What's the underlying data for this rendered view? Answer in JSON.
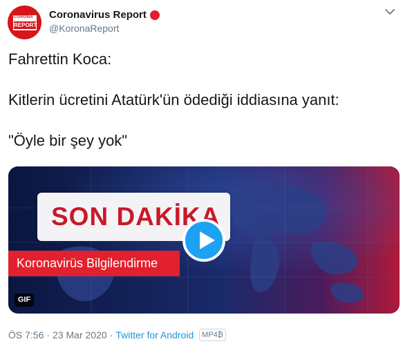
{
  "account": {
    "display_name": "Coronavirus Report",
    "handle": "@KoronaReport",
    "avatar_top": "CORONA",
    "avatar_bottom": "REPORT"
  },
  "tweet": {
    "line1": "Fahrettin Koca:",
    "line2": "Kitlerin ücretini Atatürk'ün ödediği iddiasına yanıt:",
    "line3": "\"Öyle bir şey yok\""
  },
  "media": {
    "headline": "SON DAKİKA",
    "strip": "Koronavirüs Bilgilendirme",
    "badge": "GIF"
  },
  "footer": {
    "time": "ÖS 7:56",
    "separator": "·",
    "date": "23 Mar 2020",
    "source": "Twitter for Android",
    "media_tag": "MP4₿"
  },
  "colors": {
    "brand_red": "#e0202d",
    "link_blue": "#1b95e0",
    "play_blue": "#1da1f2"
  },
  "icons": [
    "chevron-down-icon",
    "play-icon",
    "red-circle-icon"
  ]
}
